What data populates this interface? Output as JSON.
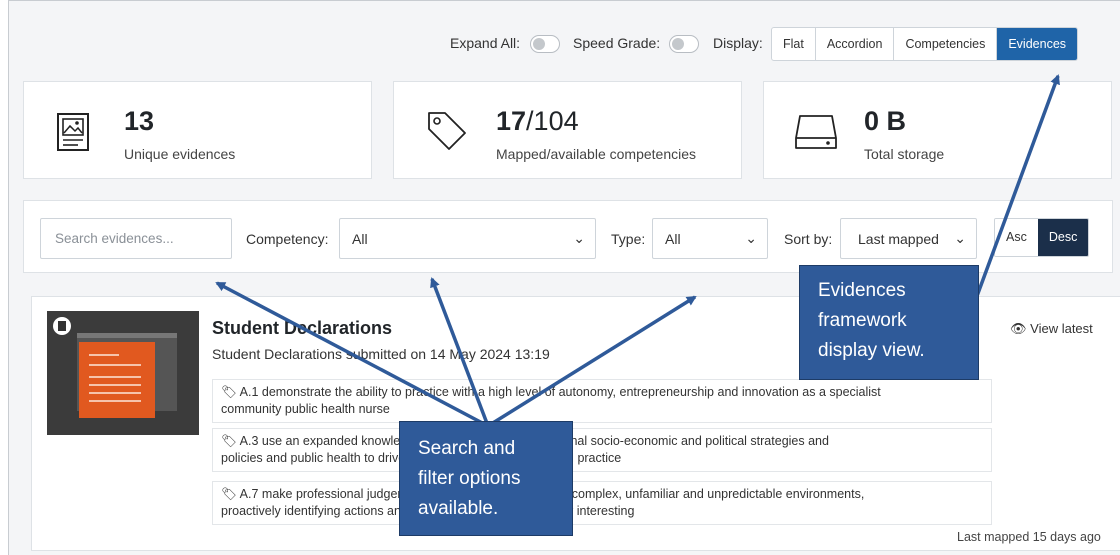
{
  "topbar": {
    "expand_all_label": "Expand All:",
    "speed_grade_label": "Speed Grade:",
    "display_label": "Display:",
    "display_options": [
      "Flat",
      "Accordion",
      "Competencies",
      "Evidences"
    ],
    "display_selected": "Evidences"
  },
  "stats": [
    {
      "icon": "image-document-icon",
      "value": "13",
      "value_suffix": "",
      "label": "Unique evidences"
    },
    {
      "icon": "tag-icon",
      "value": "17",
      "value_suffix": "/104",
      "label": "Mapped/available competencies"
    },
    {
      "icon": "hard-drive-icon",
      "value": "0 B",
      "value_suffix": "",
      "label": "Total storage"
    }
  ],
  "filters": {
    "search_placeholder": "Search evidences...",
    "competency_label": "Competency:",
    "competency_value": "All",
    "type_label": "Type:",
    "type_value": "All",
    "sort_label": "Sort by:",
    "sort_value": "Last mapped",
    "order_options": [
      "Asc",
      "Desc"
    ],
    "order_selected": "Desc"
  },
  "evidence": {
    "title": "Student Declarations",
    "subtitle": "Student Declarations submitted on 14 May 2024 13:19",
    "view_latest": "View latest",
    "tags": [
      {
        "line1": "A.1 demonstrate the ability to practice with a high level of autonomy, entrepreneurship and innovation as a specialist",
        "line2": "community public health nurse"
      },
      {
        "line1": "A.3 use an expanded knowledge of local, regional and national socio-economic and political strategies and",
        "line2": "policies and public health to drive practice in the field of SCPHN practice"
      },
      {
        "line1": "A.7 make professional judgements and decisions to work in complex, unfamiliar and unpredictable environments,",
        "line2": "proactively identifying actions and services that may have many interesting"
      }
    ],
    "last_mapped": "Last mapped 15 days ago"
  },
  "callouts": {
    "evidences_view": [
      "Evidences",
      "framework",
      "display view."
    ],
    "search_filter": [
      "Search and",
      "filter options",
      "available."
    ]
  },
  "colors": {
    "accent": "#1f64a8",
    "dark": "#1b2f4a",
    "callout": "#2f5a99",
    "thumbnail_doc": "#e1591f"
  }
}
